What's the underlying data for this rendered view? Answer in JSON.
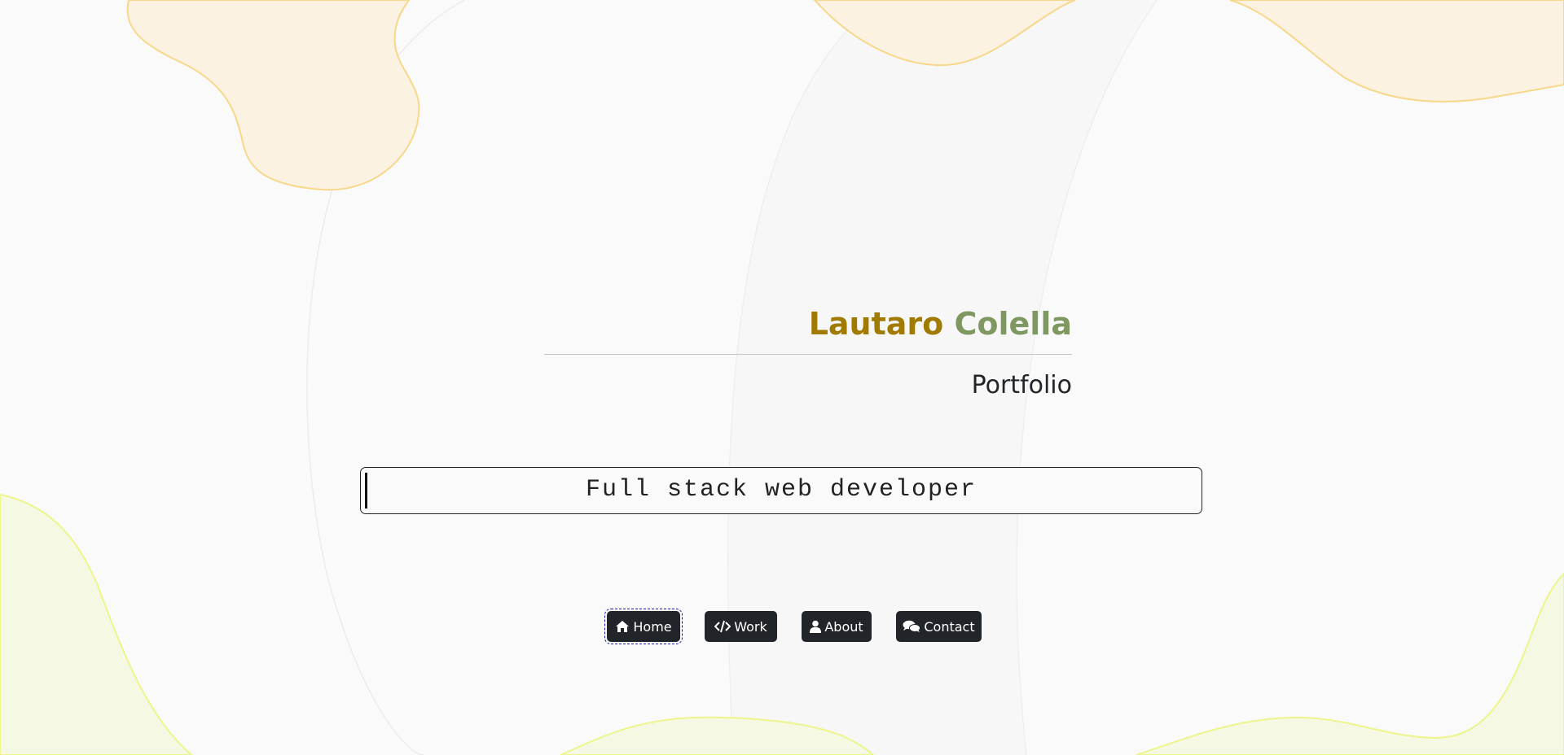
{
  "header": {
    "first_name": "Lautaro",
    "last_name": "Colella",
    "subtitle": "Portfolio"
  },
  "typewriter": {
    "text": "Full stack web developer"
  },
  "nav": {
    "home": "Home",
    "work": "Work",
    "about": "About",
    "contact": "Contact"
  },
  "icons": {
    "home": "home-icon",
    "work": "code-icon",
    "about": "user-icon",
    "contact": "comments-icon"
  },
  "colors": {
    "background": "#fafafa",
    "first_name": "#a07b00",
    "last_name": "#7f9760",
    "button": "#212529",
    "blob_orange": "#fcf2e1",
    "blob_orange_stroke": "#f7d88a",
    "blob_green": "#f5f9e3",
    "blob_green_stroke": "#eef58a"
  }
}
